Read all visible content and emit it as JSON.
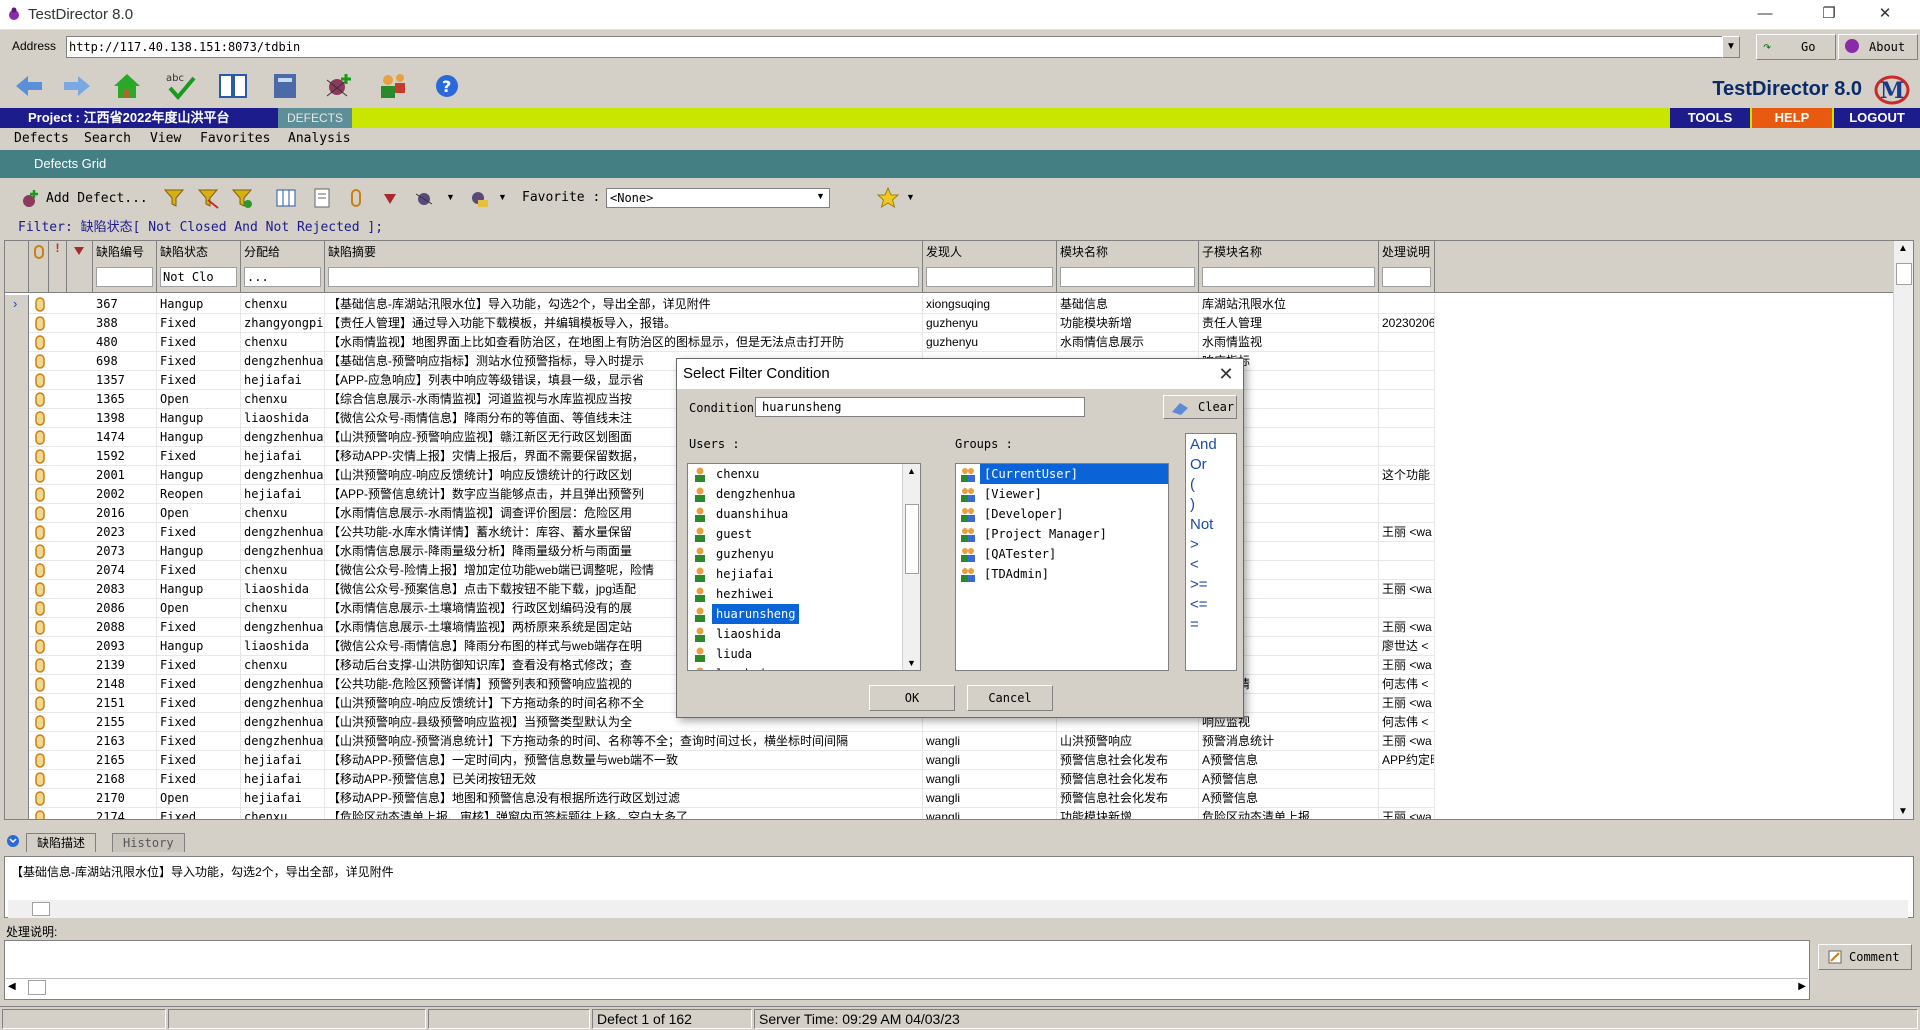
{
  "window": {
    "title": "TestDirector 8.0",
    "min": "—",
    "max": "❐",
    "close": "✕"
  },
  "address": {
    "label": "Address",
    "url": "http://117.40.138.151:8073/tdbin",
    "go": "Go",
    "about": "About"
  },
  "brand": "TestDirector 8.0",
  "project": {
    "label": "Project : 江西省2022年度山洪平台",
    "module": "DEFECTS",
    "menu": [
      "TOOLS",
      "HELP",
      "LOGOUT"
    ]
  },
  "menubar": [
    "Defects",
    "Search",
    "View",
    "Favorites",
    "Analysis"
  ],
  "grid_title": "Defects Grid",
  "grid_toolbar": {
    "add_defect": "Add Defect...",
    "favorite_label": "Favorite :",
    "favorite_value": "<None>"
  },
  "filter_text": "Filter: 缺陷状态[ Not  Closed  And  Not  Rejected ];",
  "columns": [
    {
      "title": "缺陷编号",
      "filter": ""
    },
    {
      "title": "缺陷状态",
      "filter": "Not  Clo"
    },
    {
      "title": "分配给",
      "filter": "..."
    },
    {
      "title": "缺陷摘要",
      "filter": ""
    },
    {
      "title": "发现人",
      "filter": ""
    },
    {
      "title": "模块名称",
      "filter": ""
    },
    {
      "title": "子模块名称",
      "filter": ""
    },
    {
      "title": "处理说明",
      "filter": ""
    }
  ],
  "rows": [
    [
      "367",
      "Hangup",
      "chenxu",
      "【基础信息-库湖站汛限水位】导入功能，勾选2个，导出全部，详见附件",
      "xiongsuqing",
      "基础信息",
      "库湖站汛限水位",
      ""
    ],
    [
      "388",
      "Fixed",
      "zhangyongpi",
      "【责任人管理】通过导入功能下载模板，并编辑模板导入，报错。",
      "guzhenyu",
      "功能模块新增",
      "责任人管理",
      "20230206"
    ],
    [
      "480",
      "Fixed",
      "chenxu",
      "【水雨情监视】地图界面上比如查看防治区，在地图上有防治区的图标显示，但是无法点击打开防",
      "guzhenyu",
      "水雨情信息展示",
      "水雨情监视",
      ""
    ],
    [
      "698",
      "Fixed",
      "dengzhenhua",
      "【基础信息-预警响应指标】测站水位预警指标，导入时提示",
      "",
      "",
      "响应指标",
      ""
    ],
    [
      "1357",
      "Fixed",
      "hejiafai",
      "【APP-应急响应】列表中响应等级错误，填县一级，显示省",
      "",
      "",
      "应",
      ""
    ],
    [
      "1365",
      "Open",
      "chenxu",
      "【综合信息展示-水雨情监视】河道监视与水库监视应当按",
      "",
      "",
      "视",
      ""
    ],
    [
      "1398",
      "Hangup",
      "liaoshida",
      "【微信公众号-雨情信息】降雨分布的等值面、等值线未注",
      "",
      "",
      "息",
      ""
    ],
    [
      "1474",
      "Hangup",
      "dengzhenhua",
      "【山洪预警响应-预警响应监视】赣江新区无行政区划图面",
      "",
      "",
      "视",
      ""
    ],
    [
      "1592",
      "Fixed",
      "hejiafai",
      "【移动APP-灾情上报】灾情上报后，界面不需要保留数据，",
      "",
      "",
      "报",
      ""
    ],
    [
      "2001",
      "Hangup",
      "dengzhenhua",
      "【山洪预警响应-响应反馈统计】响应反馈统计的行政区划",
      "",
      "",
      "统计",
      "这个功能"
    ],
    [
      "2002",
      "Reopen",
      "hejiafai",
      "【APP-预警信息统计】数字应当能够点击，并且弹出预警列",
      "",
      "",
      "计",
      ""
    ],
    [
      "2016",
      "Open",
      "chenxu",
      "【水雨情信息展示-水雨情监视】调查评价图层：危险区用",
      "",
      "",
      "视",
      ""
    ],
    [
      "2023",
      "Fixed",
      "dengzhenhua",
      "【公共功能-水库水情详情】蓄水统计：库容、蓄水量保留",
      "",
      "",
      "详情",
      "王丽 <wa"
    ],
    [
      "2073",
      "Hangup",
      "dengzhenhua",
      "【水雨情信息展示-降雨量级分析】降雨量级分析与雨面量",
      "",
      "",
      "分析",
      ""
    ],
    [
      "2074",
      "Fixed",
      "chenxu",
      "【微信公众号-险情上报】增加定位功能web端已调整呢，险情",
      "",
      "",
      "报",
      ""
    ],
    [
      "2083",
      "Hangup",
      "liaoshida",
      "【微信公众号-预案信息】点击下载按钮不能下载，jpg适配",
      "",
      "",
      "息",
      "王丽 <wa"
    ],
    [
      "2086",
      "Open",
      "chenxu",
      "【水雨情信息展示-土壤墒情监视】行政区划编码没有的展",
      "",
      "",
      "监视",
      ""
    ],
    [
      "2088",
      "Fixed",
      "dengzhenhua",
      "【水雨情信息展示-土壤墒情监视】两桥原来系统是固定站",
      "",
      "",
      "监视",
      "王丽 <wa"
    ],
    [
      "2093",
      "Hangup",
      "liaoshida",
      "【微信公众号-雨情信息】降雨分布图的样式与web端存在明",
      "",
      "",
      "息",
      "廖世达 <"
    ],
    [
      "2139",
      "Fixed",
      "chenxu",
      "【移动后台支撑-山洪防御知识库】查看没有格式修改；查",
      "",
      "",
      "知识库",
      "王丽 <wa"
    ],
    [
      "2148",
      "Fixed",
      "dengzhenhua",
      "【公共功能-危险区预警详情】预警列表和预警响应监视的",
      "",
      "",
      "预警详情",
      "何志伟 <"
    ],
    [
      "2151",
      "Fixed",
      "dengzhenhua",
      "【山洪预警响应-响应反馈统计】下方拖动条的时间名称不全",
      "",
      "",
      "统计",
      "王丽 <wa"
    ],
    [
      "2155",
      "Fixed",
      "dengzhenhua",
      "【山洪预警响应-县级预警响应监视】当预警类型默认为全",
      "",
      "",
      "响应监视",
      "何志伟 <"
    ],
    [
      "2163",
      "Fixed",
      "dengzhenhua",
      "【山洪预警响应-预警消息统计】下方拖动条的时间、名称等不全；查询时间过长，横坐标时间间隔",
      "wangli",
      "山洪预警响应",
      "预警消息统计",
      "王丽 <wa"
    ],
    [
      "2165",
      "Fixed",
      "hejiafai",
      "【移动APP-预警信息】一定时间内，预警信息数量与web端不一致",
      "wangli",
      "预警信息社会化发布",
      "A预警信息",
      "APP约定时"
    ],
    [
      "2168",
      "Fixed",
      "hejiafai",
      "【移动APP-预警信息】已关闭按钮无效",
      "wangli",
      "预警信息社会化发布",
      "A预警信息",
      ""
    ],
    [
      "2170",
      "Open",
      "hejiafai",
      "【移动APP-预警信息】地图和预警信息没有根据所选行政区划过滤",
      "wangli",
      "预警信息社会化发布",
      "A预警信息",
      ""
    ],
    [
      "2174",
      "Fixed",
      "chenxu",
      "【危险区动态清单上报、审核】弹窗内页签标题往上移，空白太多了",
      "wangli",
      "功能模块新增",
      "危险区动态清单上报",
      "王丽 <wa"
    ]
  ],
  "lower": {
    "tabs": [
      "缺陷描述",
      "History"
    ],
    "description": "【基础信息-库湖站汛限水位】导入功能，勾选2个，导出全部，详见附件",
    "comment_label": "处理说明:",
    "comment_button": "Comment"
  },
  "status": {
    "record": "Defect 1 of 162",
    "server_time": "Server Time: 09:29 AM 04/03/23"
  },
  "dialog": {
    "title": "Select Filter Condition",
    "condition_label": "Condition",
    "condition_value": "huarunsheng",
    "clear": "Clear",
    "users_label": "Users :",
    "groups_label": "Groups :",
    "users": [
      "chenxu",
      "dengzhenhua",
      "duanshihua",
      "guest",
      "guzhenyu",
      "hejiafai",
      "hezhiwei",
      "huarunsheng",
      "liaoshida",
      "liuda",
      "longhui"
    ],
    "selected_user": "huarunsheng",
    "groups": [
      "[CurrentUser]",
      "[Viewer]",
      "[Developer]",
      "[Project Manager]",
      "[QATester]",
      "[TDAdmin]"
    ],
    "selected_group": "[CurrentUser]",
    "operators": [
      "And",
      "Or",
      "(",
      ")",
      "Not",
      ">",
      "<",
      ">=",
      "<=",
      "="
    ],
    "ok": "OK",
    "cancel": "Cancel"
  },
  "colors": {
    "project_bar": "#c8e600",
    "project_label_bg": "#1c1c8c",
    "grid_title_bg": "#447f84",
    "selection": "#0a64d8"
  }
}
